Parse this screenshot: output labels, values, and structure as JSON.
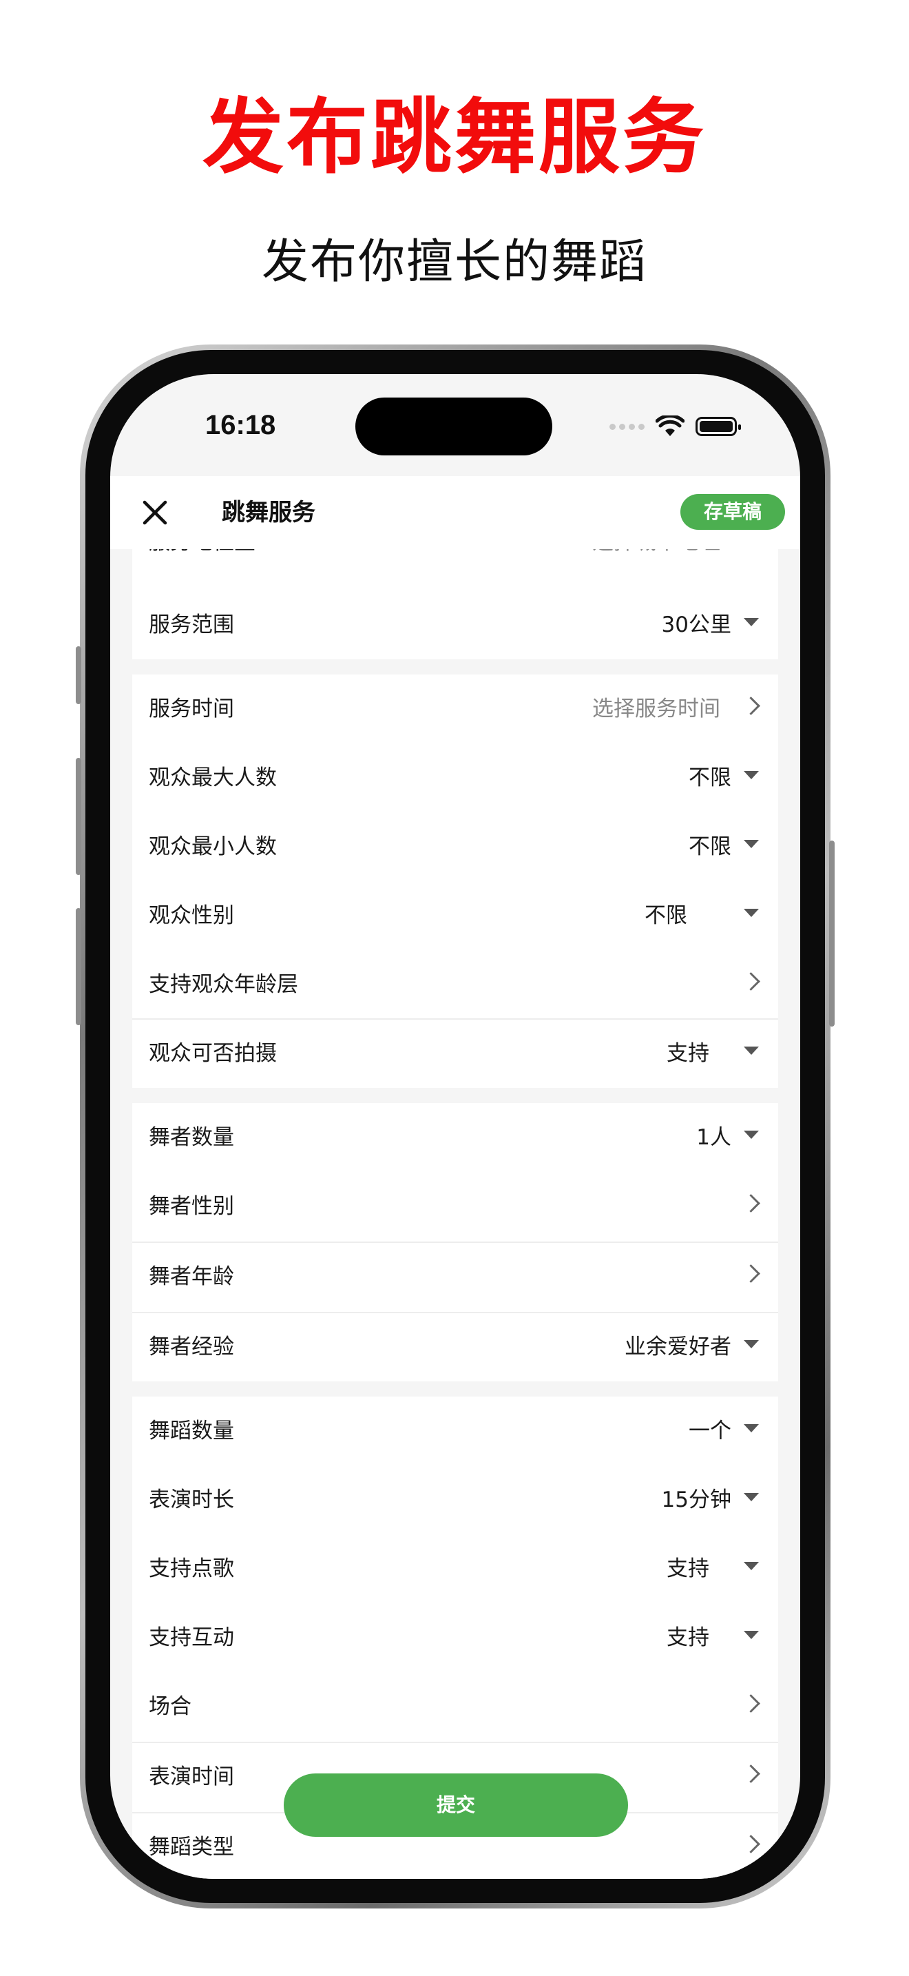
{
  "promo": {
    "headline": "发布跳舞服务",
    "subline": "发布你擅长的舞蹈"
  },
  "status": {
    "time": "16:18"
  },
  "nav": {
    "title": "跳舞服务",
    "draft_label": "存草稿"
  },
  "sections": {
    "s1": {
      "partial_label": "服务地位置",
      "partial_value": "选择城市地址",
      "scope_label": "服务范围",
      "scope_value": "30公里"
    },
    "s2": [
      {
        "label": "服务时间",
        "value": "选择服务时间"
      },
      {
        "label": "观众最大人数",
        "value": "不限"
      },
      {
        "label": "观众最小人数",
        "value": "不限"
      },
      {
        "label": "观众性别",
        "value": "不限"
      },
      {
        "label": "支持观众年龄层",
        "value": ""
      },
      {
        "label": "观众可否拍摄",
        "value": "支持"
      }
    ],
    "s3": [
      {
        "label": "舞者数量",
        "value": "1人"
      },
      {
        "label": "舞者性别",
        "value": ""
      },
      {
        "label": "舞者年龄",
        "value": ""
      },
      {
        "label": "舞者经验",
        "value": "业余爱好者"
      }
    ],
    "s4": [
      {
        "label": "舞蹈数量",
        "value": "一个"
      },
      {
        "label": "表演时长",
        "value": "15分钟"
      },
      {
        "label": "支持点歌",
        "value": "支持"
      },
      {
        "label": "支持互动",
        "value": "支持"
      },
      {
        "label": "场合",
        "value": ""
      },
      {
        "label": "表演时间",
        "value": ""
      },
      {
        "label": "舞蹈类型",
        "value": ""
      }
    ]
  },
  "submit_label": "提交",
  "colors": {
    "accent_green": "#4caf50",
    "headline_red": "#f20c0c"
  },
  "icons": [
    "close-icon",
    "wifi-icon",
    "battery-icon",
    "dropdown-arrow-icon",
    "chevron-right-icon"
  ]
}
